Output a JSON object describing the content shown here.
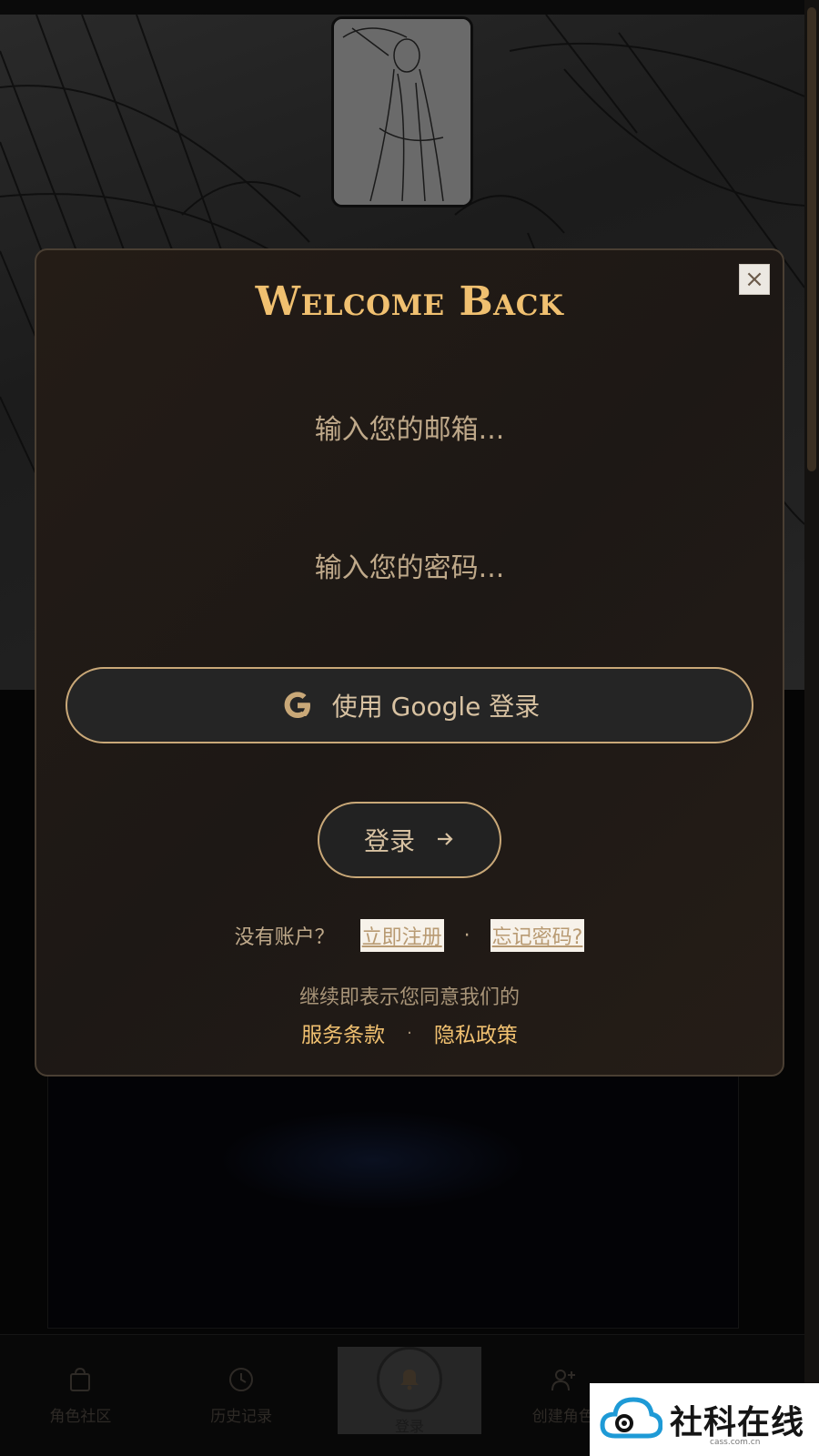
{
  "modal": {
    "title": "Welcome Back",
    "close_symbol": "×",
    "email_placeholder": "输入您的邮箱...",
    "password_placeholder": "输入您的密码...",
    "google_button": "使用 Google 登录",
    "login_button": "登录",
    "no_account": "没有账户？",
    "register_link": "立即注册",
    "separator": "·",
    "forgot_link": "忘记密码?",
    "agree_text": "继续即表示您同意我们的",
    "terms_link": "服务条款",
    "privacy_link": "隐私政策"
  },
  "bottom_nav": {
    "items": [
      {
        "label": "角色社区",
        "icon": "shopping-bag-icon"
      },
      {
        "label": "历史记录",
        "icon": "clock-icon"
      },
      {
        "label": "登录",
        "icon": "bell-icon"
      },
      {
        "label": "创建角色",
        "icon": "user-plus-icon"
      },
      {
        "label": "",
        "icon": "box-icon"
      }
    ]
  },
  "watermark": {
    "text": "社科在线",
    "sub": "cass.com.cn"
  },
  "colors": {
    "accent_gold": "#f0c070",
    "border_gold": "#c9a878",
    "modal_bg": "#1f1915"
  }
}
